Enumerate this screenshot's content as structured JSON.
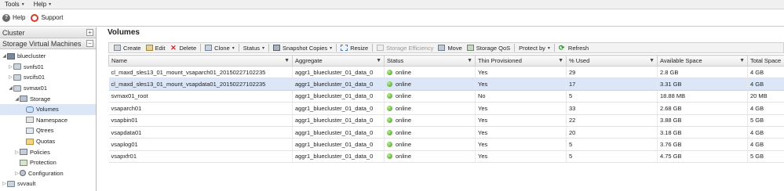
{
  "menubar": {
    "items": [
      "Tools",
      "Help"
    ]
  },
  "helpbar": {
    "help_label": "Help",
    "support_label": "Support"
  },
  "left": {
    "cluster_header": "Cluster",
    "cluster_btn": "+",
    "svm_header": "Storage Virtual Machines",
    "svm_btn": "−",
    "tree": [
      {
        "label": "bluecluster",
        "expander": "◢",
        "icon": "cluster-icon"
      },
      {
        "label": "svnfs01",
        "expander": "▷",
        "icon": "svm-icon"
      },
      {
        "label": "svcifs01",
        "expander": "▷",
        "icon": "svm-icon"
      },
      {
        "label": "svmax01",
        "expander": "◢",
        "icon": "svm-icon"
      },
      {
        "label": "Storage",
        "expander": "◢",
        "icon": "storage-icon"
      },
      {
        "label": "Volumes",
        "expander": "",
        "icon": "volume-icon"
      },
      {
        "label": "Namespace",
        "expander": "",
        "icon": "namespace-icon"
      },
      {
        "label": "Qtrees",
        "expander": "",
        "icon": "qtree-icon"
      },
      {
        "label": "Quotas",
        "expander": "",
        "icon": "quota-icon"
      },
      {
        "label": "Policies",
        "expander": "▷",
        "icon": "policy-icon"
      },
      {
        "label": "Protection",
        "expander": "",
        "icon": "protection-icon"
      },
      {
        "label": "Configuration",
        "expander": "▷",
        "icon": "configuration-icon"
      },
      {
        "label": "svvault",
        "expander": "▷",
        "icon": "svm-icon"
      }
    ]
  },
  "main": {
    "title": "Volumes",
    "toolbar": {
      "create": "Create",
      "edit": "Edit",
      "delete": "Delete",
      "clone": "Clone",
      "status": "Status",
      "snapshot": "Snapshot Copies",
      "resize": "Resize",
      "efficiency": "Storage Efficiency",
      "move": "Move",
      "qos": "Storage QoS",
      "protect": "Protect by",
      "refresh": "Refresh"
    },
    "columns": [
      "Name",
      "Aggregate",
      "Status",
      "Thin Provisioned",
      "% Used",
      "Available Space",
      "Total Space"
    ],
    "rows": [
      {
        "name": "cl_maxd_sles13_01_mount_vsaparch01_20150227102235",
        "aggregate": "aggr1_bluecluster_01_data_0",
        "status": "online",
        "thin": "Yes",
        "used": "29",
        "avail": "2.8 GB",
        "total": "4 GB"
      },
      {
        "name": "cl_maxd_sles13_01_mount_vsapdata01_20150227102235",
        "aggregate": "aggr1_bluecluster_01_data_0",
        "status": "online",
        "thin": "Yes",
        "used": "17",
        "avail": "3.31 GB",
        "total": "4 GB"
      },
      {
        "name": "svmax01_root",
        "aggregate": "aggr1_bluecluster_01_data_0",
        "status": "online",
        "thin": "No",
        "used": "5",
        "avail": "18.88 MB",
        "total": "20 MB"
      },
      {
        "name": "vsaparch01",
        "aggregate": "aggr1_bluecluster_01_data_0",
        "status": "online",
        "thin": "Yes",
        "used": "33",
        "avail": "2.68 GB",
        "total": "4 GB"
      },
      {
        "name": "vsapbin01",
        "aggregate": "aggr1_bluecluster_01_data_0",
        "status": "online",
        "thin": "Yes",
        "used": "22",
        "avail": "3.88 GB",
        "total": "5 GB"
      },
      {
        "name": "vsapdata01",
        "aggregate": "aggr1_bluecluster_01_data_0",
        "status": "online",
        "thin": "Yes",
        "used": "20",
        "avail": "3.18 GB",
        "total": "4 GB"
      },
      {
        "name": "vsaplog01",
        "aggregate": "aggr1_bluecluster_01_data_0",
        "status": "online",
        "thin": "Yes",
        "used": "5",
        "avail": "3.76 GB",
        "total": "4 GB"
      },
      {
        "name": "vsapxfr01",
        "aggregate": "aggr1_bluecluster_01_data_0",
        "status": "online",
        "thin": "Yes",
        "used": "5",
        "avail": "4.75 GB",
        "total": "5 GB"
      }
    ]
  }
}
